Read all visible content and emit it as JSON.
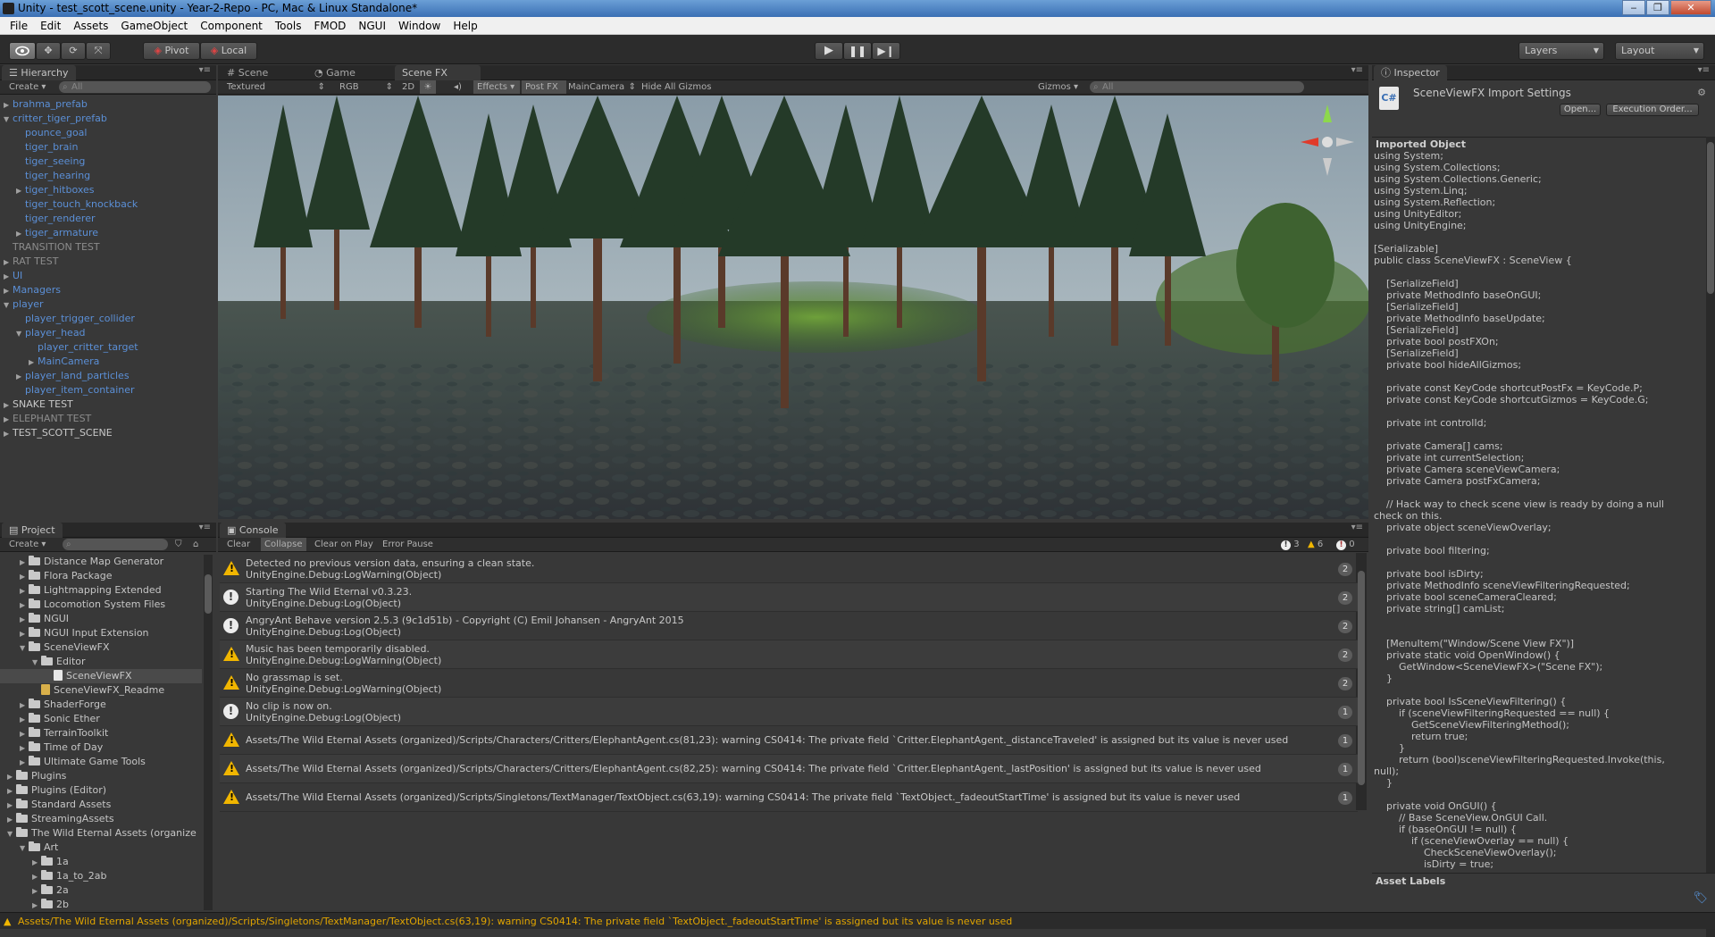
{
  "window": {
    "title": "Unity - test_scott_scene.unity - Year-2-Repo - PC, Mac & Linux Standalone*",
    "buttons": [
      "‒",
      "❐",
      "✕"
    ]
  },
  "menu": [
    "File",
    "Edit",
    "Assets",
    "GameObject",
    "Component",
    "Tools",
    "FMOD",
    "NGUI",
    "Window",
    "Help"
  ],
  "toolbar": {
    "pivot": "Pivot",
    "local": "Local",
    "layers": "Layers",
    "layout": "Layout"
  },
  "hierarchy": {
    "tab": "Hierarchy",
    "create": "Create",
    "search_placeholder": "All",
    "items": [
      {
        "label": "brahma_prefab",
        "indent": 0,
        "fold": "▶",
        "style": "blue"
      },
      {
        "label": "critter_tiger_prefab",
        "indent": 0,
        "fold": "▼",
        "style": "blue"
      },
      {
        "label": "pounce_goal",
        "indent": 1,
        "fold": "",
        "style": "blue"
      },
      {
        "label": "tiger_brain",
        "indent": 1,
        "fold": "",
        "style": "blue"
      },
      {
        "label": "tiger_seeing",
        "indent": 1,
        "fold": "",
        "style": "blue"
      },
      {
        "label": "tiger_hearing",
        "indent": 1,
        "fold": "",
        "style": "blue"
      },
      {
        "label": "tiger_hitboxes",
        "indent": 1,
        "fold": "▶",
        "style": "blue"
      },
      {
        "label": "tiger_touch_knockback",
        "indent": 1,
        "fold": "",
        "style": "blue"
      },
      {
        "label": "tiger_renderer",
        "indent": 1,
        "fold": "",
        "style": "blue"
      },
      {
        "label": "tiger_armature",
        "indent": 1,
        "fold": "▶",
        "style": "blue"
      },
      {
        "label": "TRANSITION TEST",
        "indent": 0,
        "fold": "",
        "style": "grey"
      },
      {
        "label": "RAT TEST",
        "indent": 0,
        "fold": "▶",
        "style": "grey"
      },
      {
        "label": "UI",
        "indent": 0,
        "fold": "▶",
        "style": "blue"
      },
      {
        "label": "Managers",
        "indent": 0,
        "fold": "▶",
        "style": "blue"
      },
      {
        "label": "player",
        "indent": 0,
        "fold": "▼",
        "style": "blue"
      },
      {
        "label": "player_trigger_collider",
        "indent": 1,
        "fold": "",
        "style": "blue"
      },
      {
        "label": "player_head",
        "indent": 1,
        "fold": "▼",
        "style": "blue"
      },
      {
        "label": "player_critter_target",
        "indent": 2,
        "fold": "",
        "style": "blue"
      },
      {
        "label": "MainCamera",
        "indent": 2,
        "fold": "▶",
        "style": "blue"
      },
      {
        "label": "player_land_particles",
        "indent": 1,
        "fold": "▶",
        "style": "blue"
      },
      {
        "label": "player_item_container",
        "indent": 1,
        "fold": "",
        "style": "blue"
      },
      {
        "label": "SNAKE TEST",
        "indent": 0,
        "fold": "▶",
        "style": "white"
      },
      {
        "label": "ELEPHANT TEST",
        "indent": 0,
        "fold": "▶",
        "style": "grey"
      },
      {
        "label": "TEST_SCOTT_SCENE",
        "indent": 0,
        "fold": "▶",
        "style": "white"
      }
    ]
  },
  "scene": {
    "tabs": [
      "Scene",
      "Game",
      "Scene FX"
    ],
    "shading": "Textured",
    "render": "RGB",
    "mode2d": "2D",
    "effects": "Effects",
    "postfx": "Post FX",
    "camera": "MainCamera",
    "hide_gizmos": "Hide All Gizmos",
    "gizmos": "Gizmos",
    "search_placeholder": "All"
  },
  "project": {
    "tab": "Project",
    "create": "Create",
    "items": [
      {
        "label": "Distance Map Generator",
        "indent": 1,
        "fold": "▶",
        "type": "folder"
      },
      {
        "label": "Flora Package",
        "indent": 1,
        "fold": "▶",
        "type": "folder"
      },
      {
        "label": "Lightmapping Extended",
        "indent": 1,
        "fold": "▶",
        "type": "folder"
      },
      {
        "label": "Locomotion System Files",
        "indent": 1,
        "fold": "▶",
        "type": "folder"
      },
      {
        "label": "NGUI",
        "indent": 1,
        "fold": "▶",
        "type": "folder"
      },
      {
        "label": "NGUI Input Extension",
        "indent": 1,
        "fold": "▶",
        "type": "folder"
      },
      {
        "label": "SceneViewFX",
        "indent": 1,
        "fold": "▼",
        "type": "folder"
      },
      {
        "label": "Editor",
        "indent": 2,
        "fold": "▼",
        "type": "folder"
      },
      {
        "label": "SceneViewFX",
        "indent": 3,
        "fold": "",
        "type": "script",
        "selected": true
      },
      {
        "label": "SceneViewFX_Readme",
        "indent": 2,
        "fold": "",
        "type": "doc"
      },
      {
        "label": "ShaderForge",
        "indent": 1,
        "fold": "▶",
        "type": "folder"
      },
      {
        "label": "Sonic Ether",
        "indent": 1,
        "fold": "▶",
        "type": "folder"
      },
      {
        "label": "TerrainToolkit",
        "indent": 1,
        "fold": "▶",
        "type": "folder"
      },
      {
        "label": "Time of Day",
        "indent": 1,
        "fold": "▶",
        "type": "folder"
      },
      {
        "label": "Ultimate Game Tools",
        "indent": 1,
        "fold": "▶",
        "type": "folder"
      },
      {
        "label": "Plugins",
        "indent": 0,
        "fold": "▶",
        "type": "folder"
      },
      {
        "label": "Plugins (Editor)",
        "indent": 0,
        "fold": "▶",
        "type": "folder"
      },
      {
        "label": "Standard Assets",
        "indent": 0,
        "fold": "▶",
        "type": "folder"
      },
      {
        "label": "StreamingAssets",
        "indent": 0,
        "fold": "▶",
        "type": "folder"
      },
      {
        "label": "The Wild Eternal Assets (organize",
        "indent": 0,
        "fold": "▼",
        "type": "folder"
      },
      {
        "label": "Art",
        "indent": 1,
        "fold": "▼",
        "type": "folder"
      },
      {
        "label": "1a",
        "indent": 2,
        "fold": "▶",
        "type": "folder"
      },
      {
        "label": "1a_to_2ab",
        "indent": 2,
        "fold": "▶",
        "type": "folder"
      },
      {
        "label": "2a",
        "indent": 2,
        "fold": "▶",
        "type": "folder"
      },
      {
        "label": "2b",
        "indent": 2,
        "fold": "▶",
        "type": "folder"
      }
    ]
  },
  "console": {
    "tab": "Console",
    "buttons": [
      "Clear",
      "Collapse",
      "Clear on Play",
      "Error Pause"
    ],
    "counts": {
      "info": "3",
      "warn": "6",
      "error": "0"
    },
    "rows": [
      {
        "type": "warn",
        "line1": "Detected no previous version data, ensuring a clean state.",
        "line2": "UnityEngine.Debug:LogWarning(Object)",
        "count": "2"
      },
      {
        "type": "info",
        "line1": "Starting The Wild Eternal v0.3.23.",
        "line2": "UnityEngine.Debug:Log(Object)",
        "count": "2"
      },
      {
        "type": "info",
        "line1": "AngryAnt Behave version 2.5.3 (9c1d51b) - Copyright (C) Emil Johansen - AngryAnt 2015",
        "line2": "UnityEngine.Debug:Log(Object)",
        "count": "2"
      },
      {
        "type": "warn",
        "line1": "Music has been temporarily disabled.",
        "line2": "UnityEngine.Debug:LogWarning(Object)",
        "count": "2"
      },
      {
        "type": "warn",
        "line1": "No grassmap is set.",
        "line2": "UnityEngine.Debug:LogWarning(Object)",
        "count": "2"
      },
      {
        "type": "info",
        "line1": "No clip is now on.",
        "line2": "UnityEngine.Debug:Log(Object)",
        "count": "1"
      },
      {
        "type": "warn",
        "line1": "Assets/The Wild Eternal Assets (organized)/Scripts/Characters/Critters/ElephantAgent.cs(81,23): warning CS0414: The private field `Critter.ElephantAgent._distanceTraveled' is assigned but its value is never used",
        "line2": "",
        "count": "1"
      },
      {
        "type": "warn",
        "line1": "Assets/The Wild Eternal Assets (organized)/Scripts/Characters/Critters/ElephantAgent.cs(82,25): warning CS0414: The private field `Critter.ElephantAgent._lastPosition' is assigned but its value is never used",
        "line2": "",
        "count": "1"
      },
      {
        "type": "warn",
        "line1": "Assets/The Wild Eternal Assets (organized)/Scripts/Singletons/TextManager/TextObject.cs(63,19): warning CS0414: The private field `TextObject._fadeoutStartTime' is assigned but its value is never used",
        "line2": "",
        "count": "1"
      }
    ]
  },
  "inspector": {
    "tab": "Inspector",
    "title": "SceneViewFX Import Settings",
    "open_btn": "Open...",
    "exec_btn": "Execution Order...",
    "section": "Imported Object",
    "code": "using System;\nusing System.Collections;\nusing System.Collections.Generic;\nusing System.Linq;\nusing System.Reflection;\nusing UnityEditor;\nusing UnityEngine;\n\n[Serializable]\npublic class SceneViewFX : SceneView {\n\n    [SerializeField]\n    private MethodInfo baseOnGUI;\n    [SerializeField]\n    private MethodInfo baseUpdate;\n    [SerializeField]\n    private bool postFXOn;\n    [SerializeField]\n    private bool hideAllGizmos;\n\n    private const KeyCode shortcutPostFx = KeyCode.P;\n    private const KeyCode shortcutGizmos = KeyCode.G;\n\n    private int controlId;\n\n    private Camera[] cams;\n    private int currentSelection;\n    private Camera sceneViewCamera;\n    private Camera postFxCamera;\n\n    // Hack way to check scene view is ready by doing a null\ncheck on this.\n    private object sceneViewOverlay;\n\n    private bool filtering;\n\n    private bool isDirty;\n    private MethodInfo sceneViewFilteringRequested;\n    private bool sceneCameraCleared;\n    private string[] camList;\n\n\n    [MenuItem(\"Window/Scene View FX\")]\n    private static void OpenWindow() {\n        GetWindow<SceneViewFX>(\"Scene FX\");\n    }\n\n    private bool IsSceneViewFiltering() {\n        if (sceneViewFilteringRequested == null) {\n            GetSceneViewFilteringMethod();\n            return true;\n        }\n        return (bool)sceneViewFilteringRequested.Invoke(this,\nnull);\n    }\n\n    private void OnGUI() {\n        // Base SceneView.OnGUI Call.\n        if (baseOnGUI != null) {\n            if (sceneViewOverlay == null) {\n                CheckSceneViewOverlay();\n                isDirty = true;",
    "asset_labels": "Asset Labels"
  },
  "statusbar": {
    "text": "Assets/The Wild Eternal Assets (organized)/Scripts/Singletons/TextManager/TextObject.cs(63,19): warning CS0414: The private field `TextObject._fadeoutStartTime' is assigned but its value is never used"
  }
}
